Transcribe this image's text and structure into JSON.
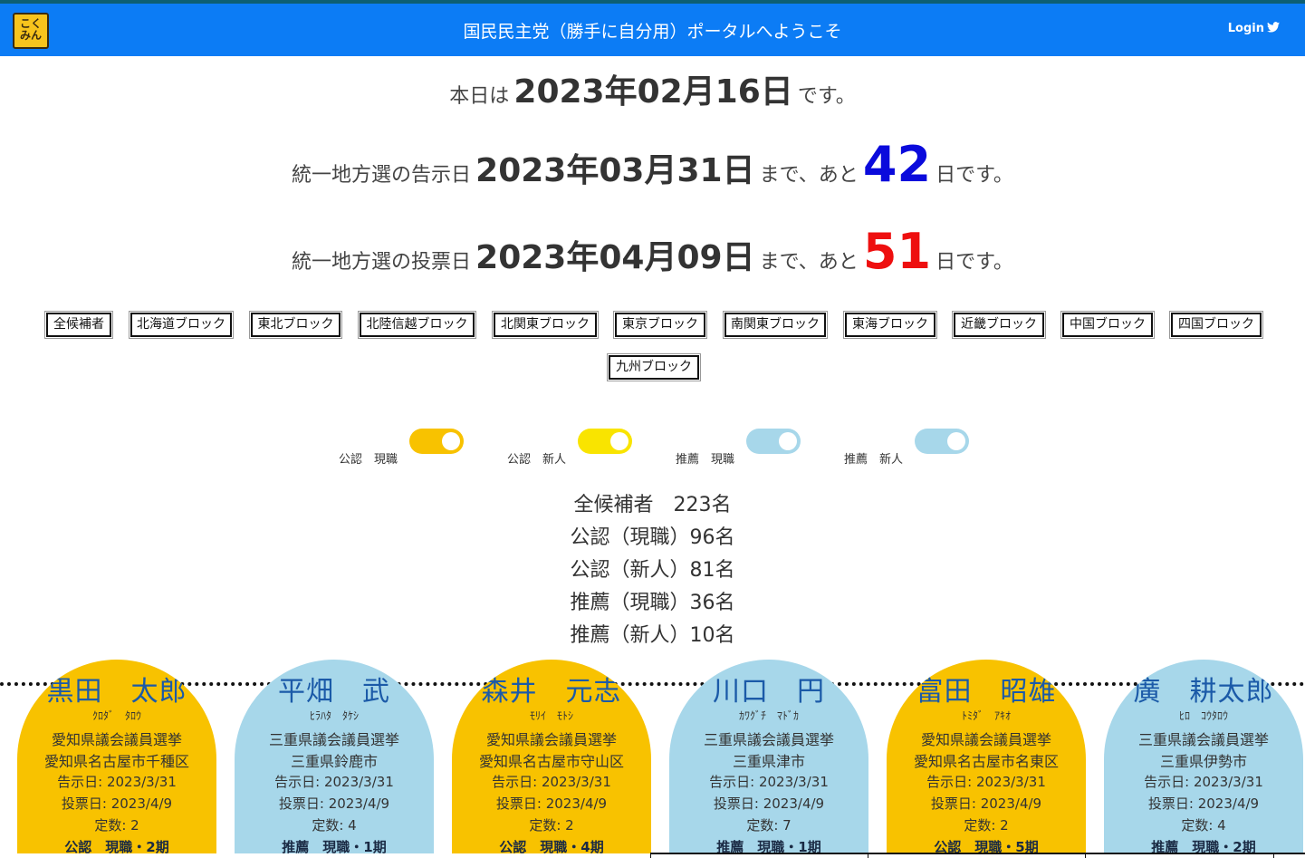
{
  "header": {
    "logo_text": "こくみん",
    "title": "国民民主党（勝手に自分用）ポータルへようこそ",
    "login_label": "Login",
    "bg_color": "#0c7cf5"
  },
  "today": {
    "prefix": "本日は",
    "date": "2023年02月16日",
    "suffix": "です。"
  },
  "kokuji": {
    "prefix": "統一地方選の告示日",
    "date": "2023年03月31日",
    "mid": "まで、あと",
    "days": "42",
    "suffix": "日です。"
  },
  "touhyou": {
    "prefix": "統一地方選の投票日",
    "date": "2023年04月09日",
    "mid": "まで、あと",
    "days": "51",
    "suffix": "日です。"
  },
  "blocks": [
    "全候補者",
    "北海道ブロック",
    "東北ブロック",
    "北陸信越ブロック",
    "北関東ブロック",
    "東京ブロック",
    "南関東ブロック",
    "東海ブロック",
    "近畿ブロック",
    "中国ブロック",
    "四国ブロック",
    "九州ブロック"
  ],
  "toggles": [
    {
      "label": "公認　現職",
      "color": "#f8c200",
      "on": true
    },
    {
      "label": "公認　新人",
      "color": "#f9e400",
      "on": true
    },
    {
      "label": "推薦　現職",
      "color": "#a7d7ea",
      "on": true
    },
    {
      "label": "推薦　新人",
      "color": "#a7d7ea",
      "on": true
    }
  ],
  "stats": [
    "全候補者　223名",
    "公認（現職）96名",
    "公認（新人）81名",
    "推薦（現職）36名",
    "推薦（新人）10名"
  ],
  "cards": [
    {
      "name": "黒田　太郎",
      "kana": "ｸﾛﾀﾞ　ﾀﾛｳ",
      "election": "愛知県議会議員選挙",
      "district": "愛知県名古屋市千種区",
      "kokuji": "告示日: 2023/3/31",
      "touhyou": "投票日: 2023/4/9",
      "teisu": "定数: 2",
      "status": "公認　現職・2期",
      "color": "yellow"
    },
    {
      "name": "平畑　武",
      "kana": "ﾋﾗﾊﾀ　ﾀｹｼ",
      "election": "三重県議会議員選挙",
      "district": "三重県鈴鹿市",
      "kokuji": "告示日: 2023/3/31",
      "touhyou": "投票日: 2023/4/9",
      "teisu": "定数: 4",
      "status": "推薦　現職・1期",
      "color": "blue"
    },
    {
      "name": "森井　元志",
      "kana": "ﾓﾘｲ　ﾓﾄｼ",
      "election": "愛知県議会議員選挙",
      "district": "愛知県名古屋市守山区",
      "kokuji": "告示日: 2023/3/31",
      "touhyou": "投票日: 2023/4/9",
      "teisu": "定数: 2",
      "status": "公認　現職・4期",
      "color": "yellow"
    },
    {
      "name": "川口　円",
      "kana": "ｶﾜｸﾞﾁ　ﾏﾄﾞｶ",
      "election": "三重県議会議員選挙",
      "district": "三重県津市",
      "kokuji": "告示日: 2023/3/31",
      "touhyou": "投票日: 2023/4/9",
      "teisu": "定数: 7",
      "status": "推薦　現職・1期",
      "color": "blue"
    },
    {
      "name": "富田　昭雄",
      "kana": "ﾄﾐﾀﾞ　ｱｷｵ",
      "election": "愛知県議会議員選挙",
      "district": "愛知県名古屋市名東区",
      "kokuji": "告示日: 2023/3/31",
      "touhyou": "投票日: 2023/4/9",
      "teisu": "定数: 2",
      "status": "公認　現職・5期",
      "color": "yellow"
    },
    {
      "name": "廣　耕太郎",
      "kana": "ﾋﾛ　ｺｳﾀﾛｳ",
      "election": "三重県議会議員選挙",
      "district": "三重県伊勢市",
      "kokuji": "告示日: 2023/3/31",
      "touhyou": "投票日: 2023/4/9",
      "teisu": "定数: 4",
      "status": "推薦　現職・2期",
      "color": "blue"
    }
  ]
}
